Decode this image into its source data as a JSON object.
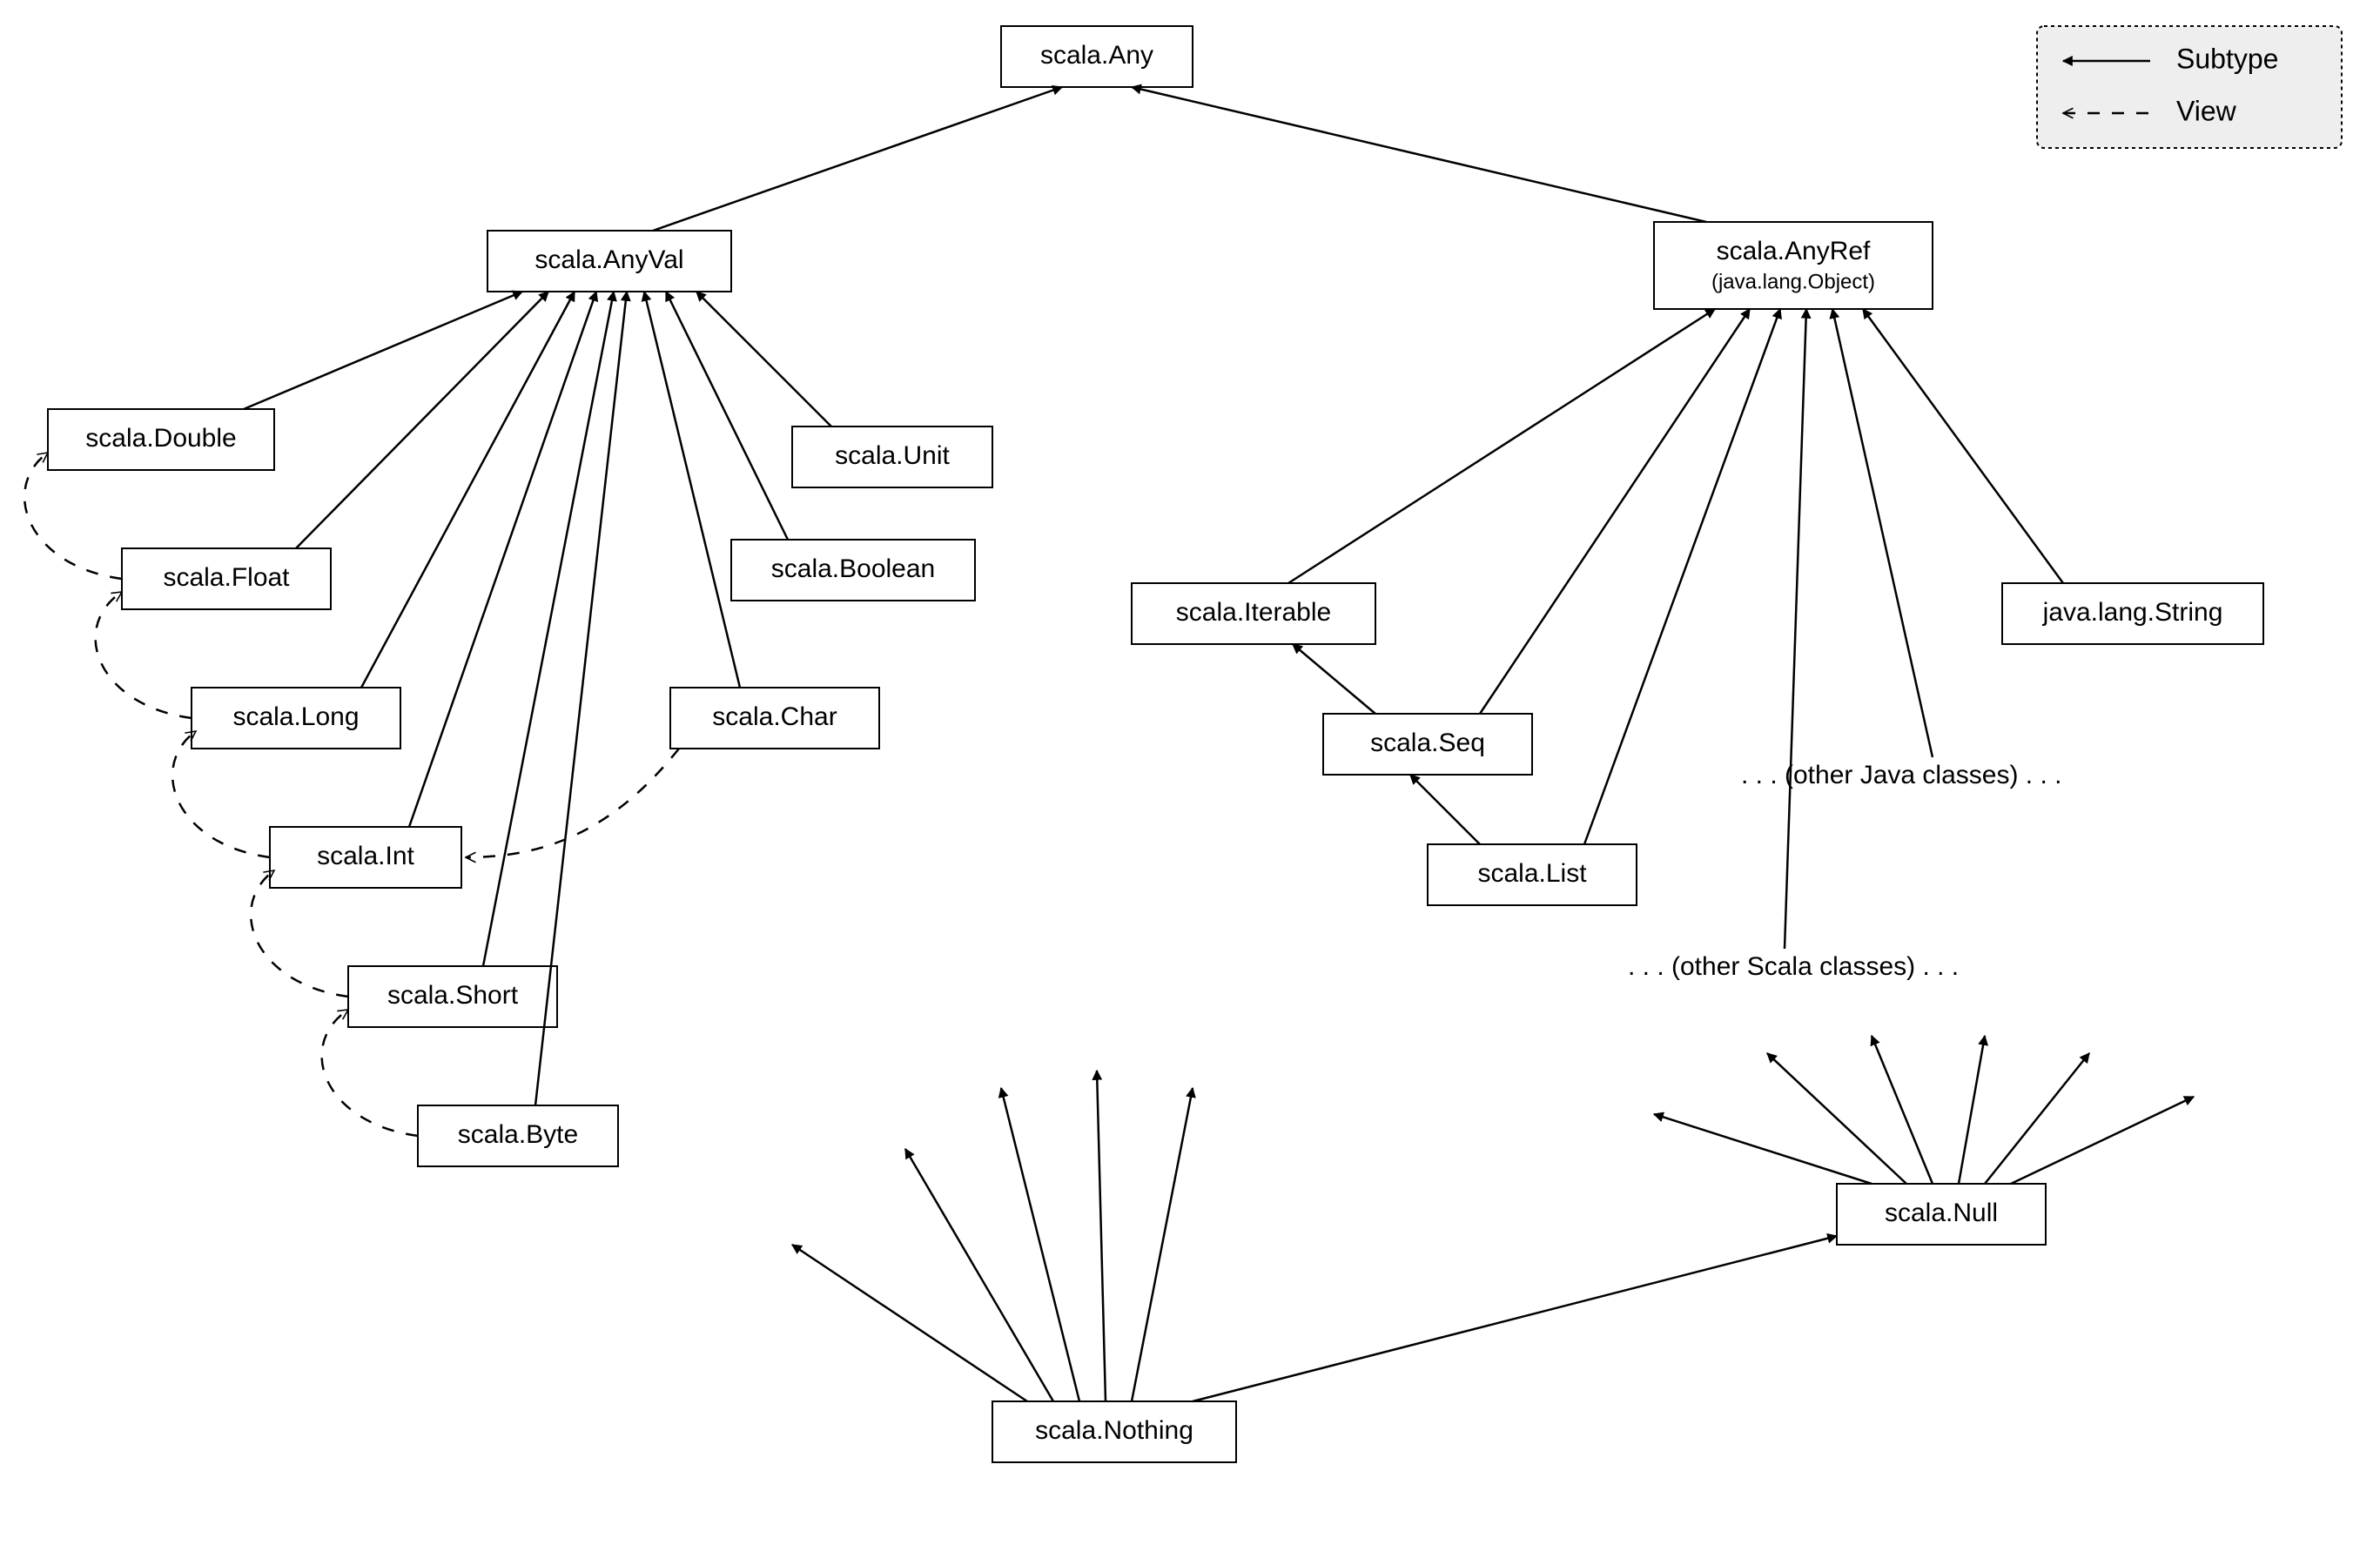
{
  "legend": {
    "subtype": "Subtype",
    "view": "View"
  },
  "nodes": {
    "any": "scala.Any",
    "anyval": "scala.AnyVal",
    "anyref": "scala.AnyRef",
    "anyref_sub": "(java.lang.Object)",
    "double": "scala.Double",
    "float": "scala.Float",
    "long": "scala.Long",
    "int": "scala.Int",
    "short": "scala.Short",
    "byte": "scala.Byte",
    "unit": "scala.Unit",
    "boolean": "scala.Boolean",
    "char": "scala.Char",
    "iterable": "scala.Iterable",
    "seq": "scala.Seq",
    "list": "scala.List",
    "string": "java.lang.String",
    "null": "scala.Null",
    "nothing": "scala.Nothing"
  },
  "notes": {
    "other_java": ". . .  (other Java classes) . . .",
    "other_scala": ". . .  (other Scala classes) . . ."
  }
}
